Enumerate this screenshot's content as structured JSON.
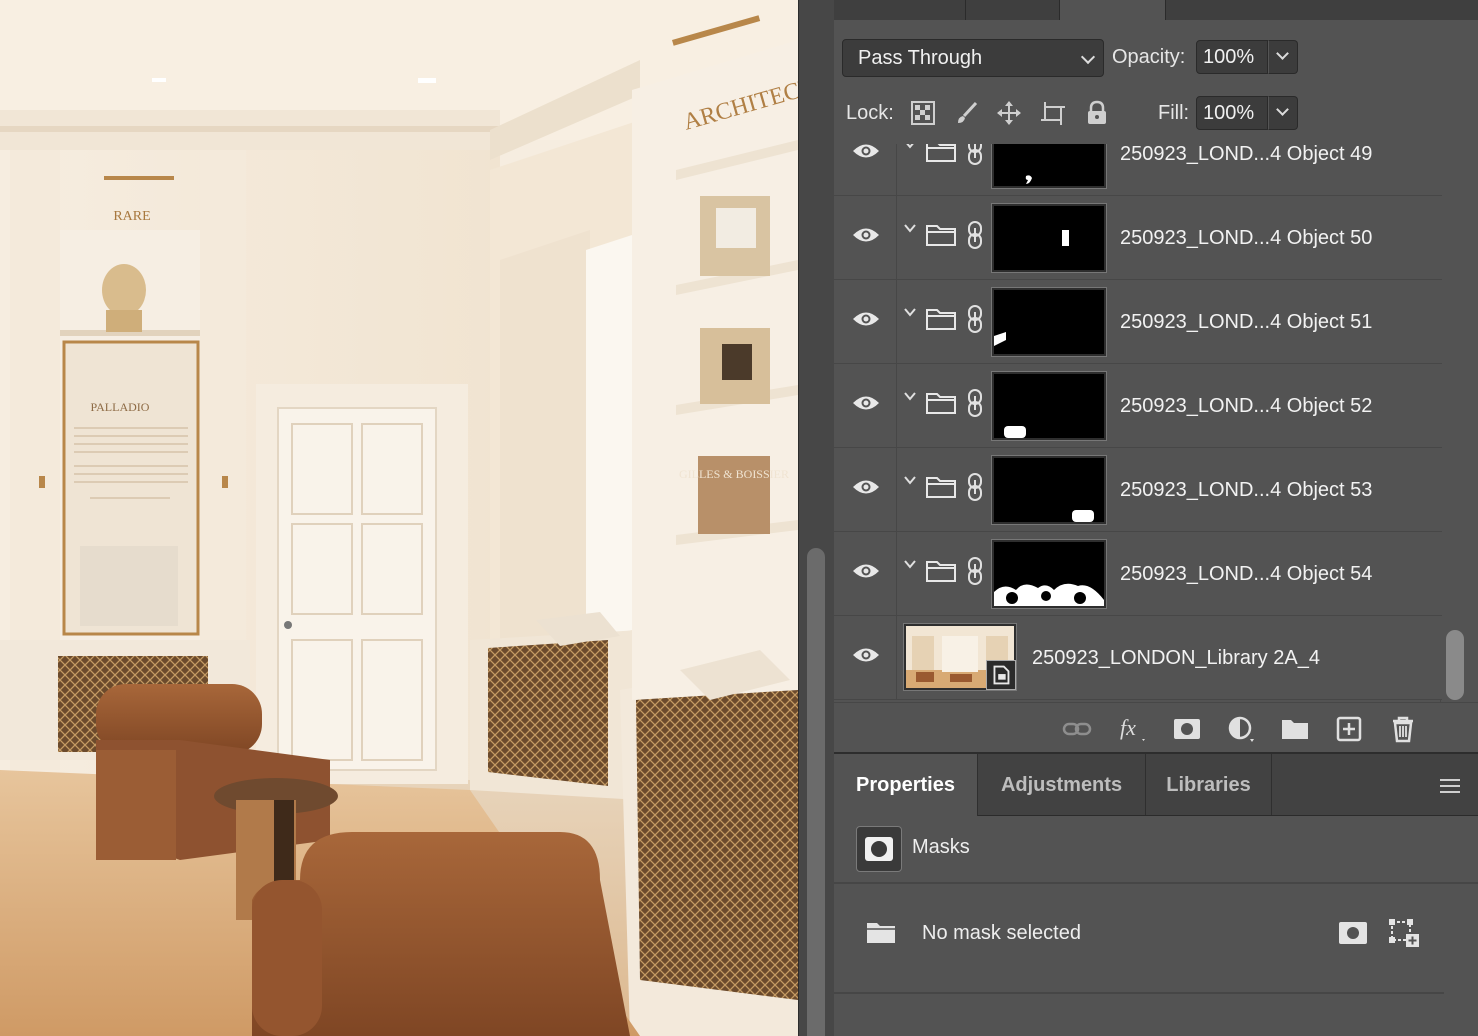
{
  "layers_panel": {
    "blend_mode": "Pass Through",
    "opacity_label": "Opacity:",
    "opacity_value": "100%",
    "lock_label": "Lock:",
    "fill_label": "Fill:",
    "fill_value": "100%",
    "layers": [
      {
        "name": "250923_LOND...4 Object 49",
        "type": "group",
        "visible": true
      },
      {
        "name": "250923_LOND...4 Object 50",
        "type": "group",
        "visible": true
      },
      {
        "name": "250923_LOND...4 Object 51",
        "type": "group",
        "visible": true
      },
      {
        "name": "250923_LOND...4 Object 52",
        "type": "group",
        "visible": true
      },
      {
        "name": "250923_LOND...4 Object 53",
        "type": "group",
        "visible": true
      },
      {
        "name": "250923_LOND...4 Object 54",
        "type": "group",
        "visible": true
      },
      {
        "name": "250923_LONDON_Library 2A_4",
        "type": "smart-object",
        "visible": true
      }
    ]
  },
  "properties_panel": {
    "tabs": [
      "Properties",
      "Adjustments",
      "Libraries"
    ],
    "active_tab": "Properties",
    "section_label": "Masks",
    "status_text": "No mask selected"
  },
  "canvas": {
    "sign_rare": "RARE",
    "plaque_title": "PALLADIO",
    "sign_architecture": "ARCHITECT",
    "book_text": "GILLES & BOISSIER"
  },
  "colors": {
    "panel_bg": "#535353",
    "field_bg": "#3c3c3c",
    "text": "#f2f2f2",
    "upholstery": "#9a5a30",
    "floor": "#d9ad7c",
    "brass": "#b8874a"
  }
}
